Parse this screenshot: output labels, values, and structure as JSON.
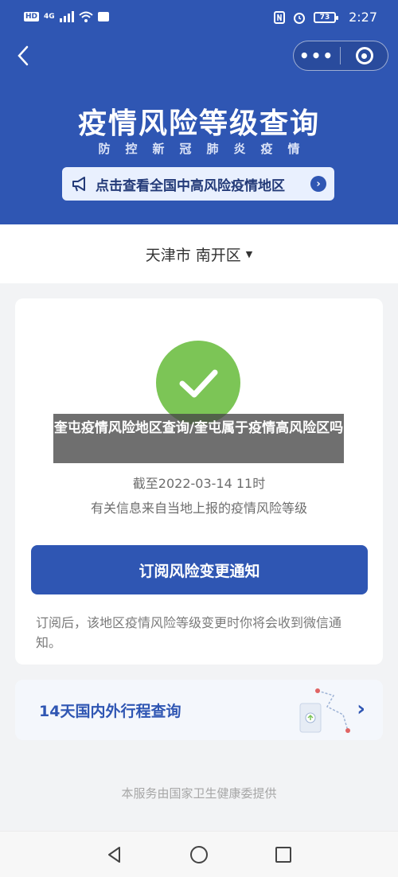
{
  "status_bar": {
    "hd": "HD",
    "network": "4G",
    "time": "2:27",
    "battery": "73"
  },
  "header": {
    "title": "疫情风险等级查询",
    "subtitle": "防控新冠肺炎疫情",
    "notice": "点击查看全国中高风险疫情地区",
    "capsule_more": "•••"
  },
  "region": {
    "label": "天津市 南开区"
  },
  "result": {
    "status_icon": "check-circle-icon",
    "status_color": "#7cc556",
    "deadline": "截至2022-03-14 11时",
    "source": "有关信息来自当地上报的疫情风险等级",
    "subscribe_label": "订阅风险变更通知",
    "subscribe_note": "订阅后，该地区疫情风险等级变更时你将会收到微信通知。"
  },
  "travel": {
    "title": "14天国内外行程查询"
  },
  "footer": {
    "provider": "本服务由国家卫生健康委提供"
  },
  "overlay": {
    "caption": "奎屯疫情风险地区查询/奎屯属于疫情高风险区吗"
  },
  "colors": {
    "brand_blue": "#2f56b3",
    "success_green": "#7cc556"
  }
}
